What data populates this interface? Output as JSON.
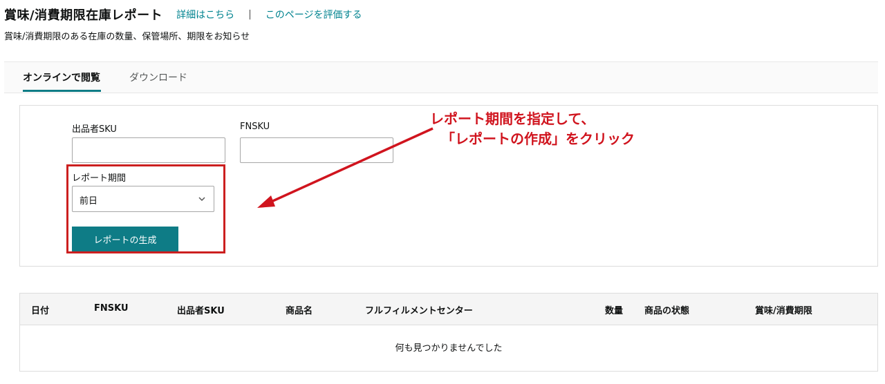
{
  "header": {
    "title": "賞味/消費期限在庫レポート",
    "link_details": "詳細はこちら",
    "separator": "|",
    "link_rate": "このページを評価する",
    "subtitle": "賞味/消費期限のある在庫の数量、保管場所、期限をお知らせ"
  },
  "tabs": {
    "online": "オンラインで閲覧",
    "download": "ダウンロード"
  },
  "filters": {
    "seller_sku_label": "出品者SKU",
    "seller_sku_value": "",
    "fnsku_label": "FNSKU",
    "fnsku_value": "",
    "period_label": "レポート期間",
    "period_value": "前日",
    "generate_label": "レポートの生成"
  },
  "annotation": {
    "line1": "レポート期間を指定して、",
    "line2": "「レポートの作成」をクリック",
    "color": "#d0141e"
  },
  "table": {
    "columns": [
      "日付",
      "FNSKU",
      "出品者SKU",
      "商品名",
      "フルフィルメントセンター",
      "数量",
      "商品の状態",
      "賞味/消費期限"
    ],
    "empty_message": "何も見つかりませんでした"
  },
  "colors": {
    "accent": "#0e7c86",
    "link": "#00838f",
    "highlight": "#cc1f1f"
  }
}
